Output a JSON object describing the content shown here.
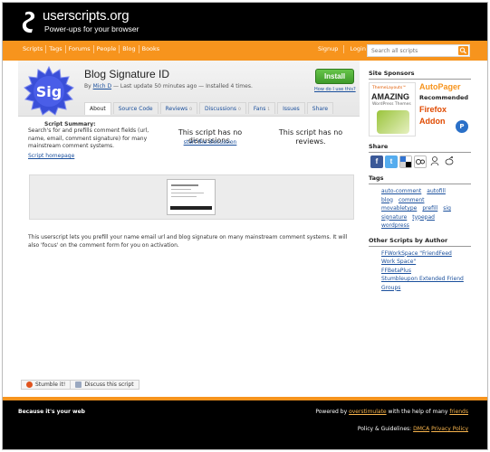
{
  "header": {
    "logo_text": "userscripts.org",
    "tagline": "Power-ups for your browser"
  },
  "nav": {
    "links": [
      "Scripts",
      "Tags",
      "Forums",
      "People",
      "Blog",
      "Books"
    ],
    "signup": "Signup",
    "login": "Login",
    "search_placeholder": "Search all scripts"
  },
  "script": {
    "badge_text": "Sig",
    "title": "Blog Signature ID",
    "by_prefix": "By",
    "author": "Mich D",
    "update_info": "— Last update 50 minutes ago — Installed 4 times.",
    "install_label": "Install",
    "how_use": "How do I use this?",
    "tabs": [
      {
        "label": "About",
        "count": ""
      },
      {
        "label": "Source Code",
        "count": ""
      },
      {
        "label": "Reviews",
        "count": "0"
      },
      {
        "label": "Discussions",
        "count": "0"
      },
      {
        "label": "Fans",
        "count": "1"
      },
      {
        "label": "Issues",
        "count": ""
      },
      {
        "label": "Share",
        "count": ""
      }
    ],
    "summary_title": "Script Summary:",
    "summary_text": "Search's for and prefills comment fields (url, name, email, comment signature) for many mainstream comment systems.",
    "homepage_link": "Script homepage",
    "no_discussions": "This script has no discussions.",
    "start_discussion": "start the discussion",
    "no_reviews": "This script has no reviews.",
    "description": "This userscript lets you prefill your name email url and blog signature on many mainstream comment systems. It will also 'focus' on the comment form for you on activation.",
    "stumble": "Stumble it!",
    "discuss": "Discuss this script"
  },
  "sidebar": {
    "sponsors_title": "Site Sponsors",
    "ad1": {
      "brand": "ThemeLayouts™",
      "headline": "AMAZING",
      "sub": "WordPress Themes"
    },
    "ad2": {
      "line1": "AutoPager",
      "line2": "Recommended",
      "line3": "Firefox",
      "line4": "Addon",
      "logo": "P"
    },
    "share_title": "Share",
    "tags_title": "Tags",
    "tags": [
      [
        "auto-comment",
        "autofill"
      ],
      [
        "blog",
        "comment"
      ],
      [
        "movabletype",
        "prefill",
        "sig"
      ],
      [
        "signature",
        "typepad"
      ],
      [
        "wordpress"
      ]
    ],
    "others_title": "Other Scripts by Author",
    "others": [
      "FFWorkSpace \"FriendFeed",
      "Work Space\"",
      "FFBetaPlus",
      "Stumbleupon Extended Friend",
      "Groups"
    ]
  },
  "footer": {
    "left": "Because it's your web",
    "powered_prefix": "Powered by",
    "powered_link": "overstimulate",
    "powered_mid": "with the help of many",
    "friends_link": "friends",
    "policy_prefix": "Policy & Guidelines:",
    "dmca": "DMCA",
    "privacy": "Privacy Policy"
  },
  "colors": {
    "accent": "#f7941d",
    "install_green": "#4caf35",
    "badge_blue": "#3a4fd8"
  }
}
